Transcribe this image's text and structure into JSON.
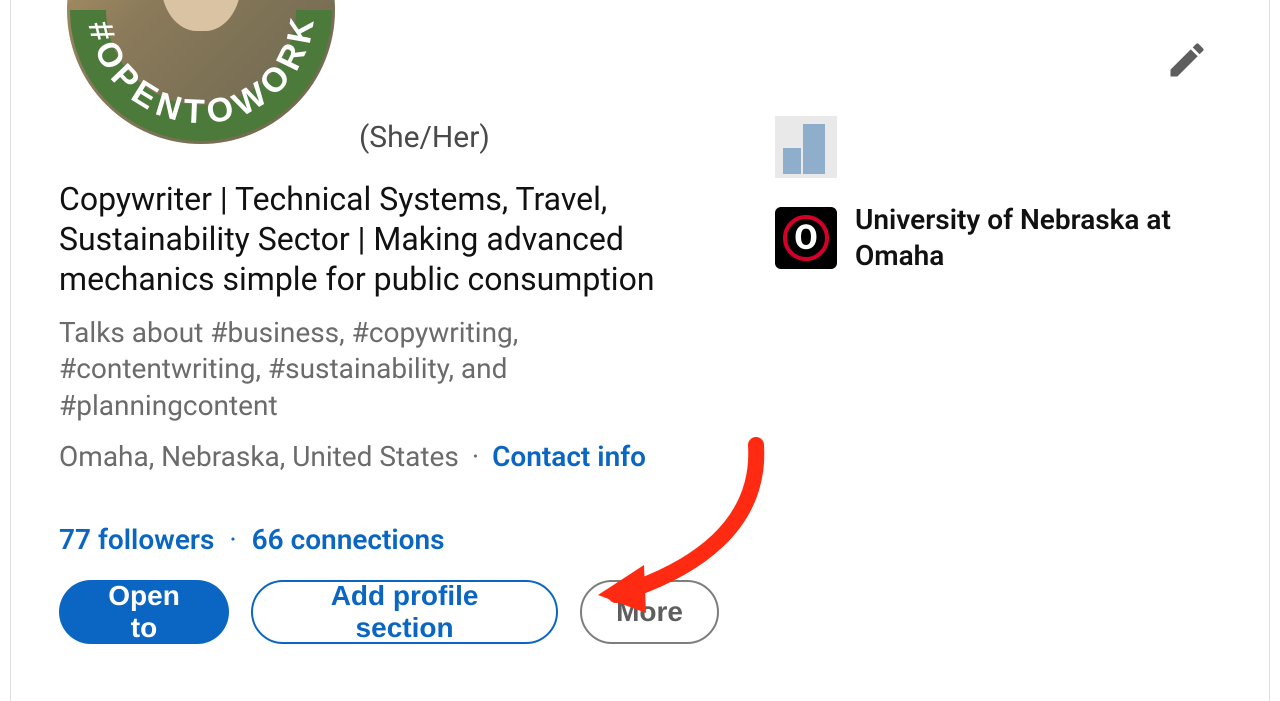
{
  "profile": {
    "pronouns": "(She/Her)",
    "open_to_work_badge": "#OPENTOWORK",
    "headline": "Copywriter | Technical Systems, Travel, Sustainability Sector | Making advanced mechanics simple for public consumption",
    "talks_about": "Talks about #business, #copywriting, #contentwriting, #sustainability, and #planningcontent",
    "location": "Omaha, Nebraska, United States",
    "contact_info_label": "Contact info",
    "followers_count": "77",
    "followers_label": "followers",
    "connections_count": "66",
    "connections_label": "connections"
  },
  "actions": {
    "open_to": "Open to",
    "add_section": "Add profile section",
    "more": "More"
  },
  "education": {
    "school_name": "University of Nebraska at Omaha"
  },
  "colors": {
    "link": "#0a66c2",
    "primary": "#0a66c2",
    "annotation": "#ff2a12"
  }
}
